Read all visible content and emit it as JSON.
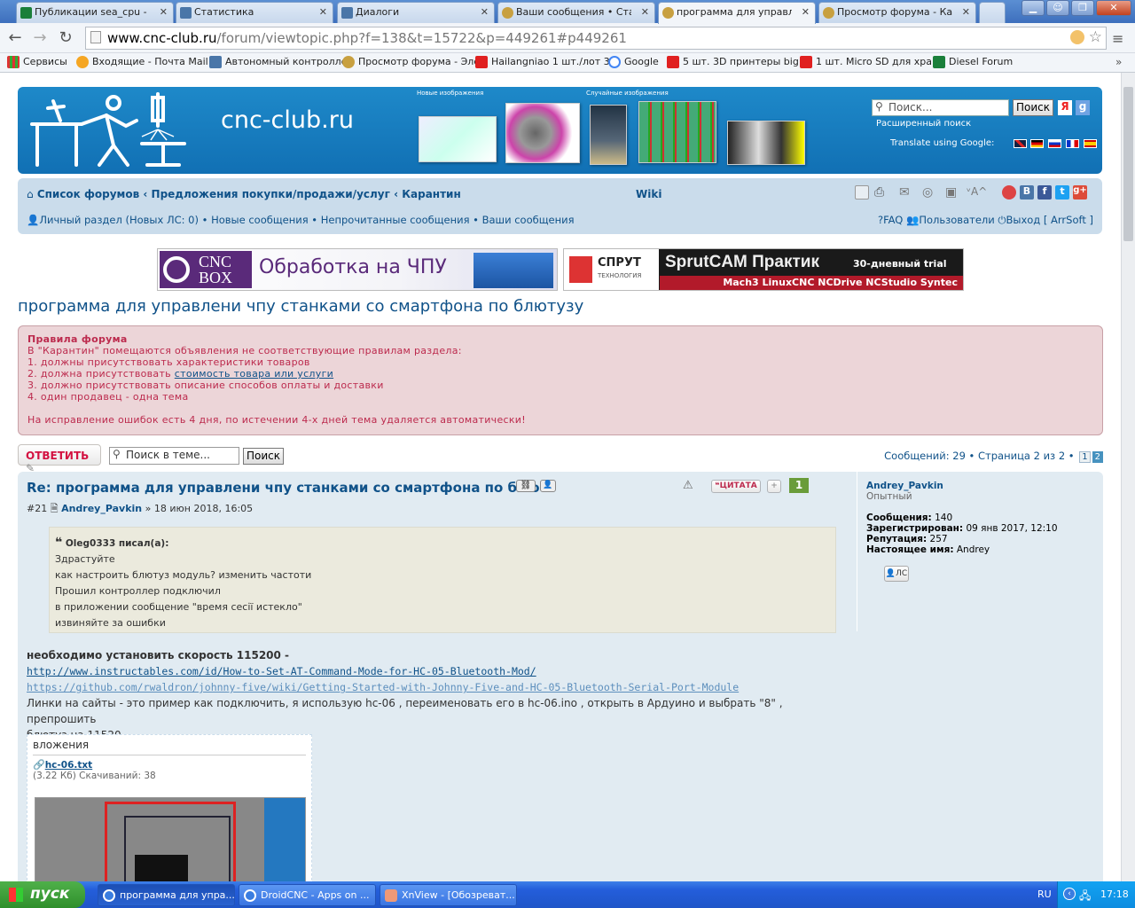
{
  "browser": {
    "tabs": [
      {
        "label": "Публикации sea_cpu - Dio",
        "color": "#1a7f3a"
      },
      {
        "label": "Статистика",
        "color": "#4a76a8"
      },
      {
        "label": "Диалоги",
        "color": "#4a76a8"
      },
      {
        "label": "Ваши сообщения • Станк",
        "color": "#c8a040"
      },
      {
        "label": "программа для управлен",
        "color": "#c8a040"
      },
      {
        "label": "Просмотр форума - Каран",
        "color": "#c8a040"
      }
    ],
    "url_host": "www.cnc-club.ru",
    "url_rest": "/forum/viewtopic.php?f=138&t=15722&p=449261#p449261",
    "bookmarks": [
      {
        "label": "Сервисы",
        "color": "#d33"
      },
      {
        "label": "Входящие - Почта Mail",
        "color": "#f5a623"
      },
      {
        "label": "Автономный контролле",
        "color": "#4a76a8"
      },
      {
        "label": "Просмотр форума - Эле",
        "color": "#c8a040"
      },
      {
        "label": "Hailangniao 1 шт./лот 3",
        "color": "#e02020"
      },
      {
        "label": "Google",
        "color": "#4285f4"
      },
      {
        "label": "5 шт. 3D принтеры big",
        "color": "#e02020"
      },
      {
        "label": "1 шт. Micro SD для хра",
        "color": "#e02020"
      },
      {
        "label": "Diesel Forum",
        "color": "#1a7f3a"
      }
    ]
  },
  "header": {
    "site_name": "cnc-club.ru",
    "new_images": "Новые изображения",
    "random_images": "Случайные изображения",
    "search_placeholder": "Поиск...",
    "search_button": "Поиск",
    "advanced_search": "Расширенный поиск",
    "translate": "Translate using Google:"
  },
  "nav": {
    "crumbs": [
      "Список форумов",
      "Предложения покупки/продажи/услуг",
      "Карантин"
    ],
    "wiki": "Wiki",
    "personal": "Личный раздел (Новых ЛС: 0)",
    "new_posts": "Новые сообщения",
    "unread": "Непрочитанные сообщения",
    "your_posts": "Ваши сообщения",
    "faq": "FAQ",
    "users": "Пользователи",
    "logout": "Выход [ ArrSoft ]"
  },
  "banners": {
    "left_brand_top": "CNC",
    "left_brand_bottom": "BOX",
    "left_text": "Обработка на ЧПУ",
    "right_brand": "СПРУТ",
    "right_brand_sub": "ТЕХНОЛОГИЯ",
    "right_title": "SprutCAM Практик",
    "right_trial": "30-дневный trial",
    "right_sub": "Mach3 LinuxCNC NCDrive NCStudio Syntec"
  },
  "topic": {
    "title": "программа для управлени чпу станками со смартфона по блютузу"
  },
  "rules": {
    "heading": "Правила форума",
    "intro": "В \"Карантин\" помещаются объявления не соответствующие правилам раздела:",
    "r1": "1. должны присутствовать характеристики товаров",
    "r2_prefix": "2. должна присутствовать ",
    "r2_link": "стоимость товара или услуги",
    "r3": "3. должно присутствовать описание способов оплаты и доставки",
    "r4": "4. один продавец - одна тема",
    "note": "На исправление ошибок есть 4 дня, по истечении 4-х дней тема удаляется автоматически!"
  },
  "actions": {
    "reply": "ОТВЕТИТЬ",
    "topic_search_placeholder": "Поиск в теме...",
    "search_button": "Поиск",
    "count_text": "Сообщений: 29",
    "page_text": "Страница 2 из 2",
    "pages": [
      "1",
      "2"
    ]
  },
  "post": {
    "title": "Re: программа для управлени чпу станками со смартфона по блю",
    "quote_btn": "ЦИТАТА",
    "number_badge": "1",
    "num": "#21",
    "author": "Andrey_Pavkin",
    "date": "» 18 июн 2018, 16:05",
    "quote_cite": "Oleg0333 писал(а):",
    "quote_lines": [
      "Здрастуйте",
      "как настроить блютуз модуль? изменить частоти",
      "Прошил контроллер подключил",
      "в приложении сообщение \"время сесії истекло\"",
      "извиняйте за ошибки"
    ],
    "bold_line": "необходимо установить скорость 115200 -",
    "link1": "http://www.instructables.com/id/How-to-Set-AT-Command-Mode-for-HC-05-Bluetooth-Mod/",
    "link2": "https://github.com/rwaldron/johnny-five/wiki/Getting-Started-with-Johnny-Five-and-HC-05-Bluetooth-Serial-Port-Module",
    "text_line1": "Линки на сайты - это пример как подключить, я использую hc-06 , переименовать его в hc-06.ino , открыть в Ардуино и выбрать \"8\" , препрошить",
    "text_line2": "блютуз на 11520",
    "attach_heading": "вложения",
    "attach_file": "hc-06.txt",
    "attach_info": "(3.22 Кб) Скачиваний: 38"
  },
  "profile": {
    "name": "Andrey_Pavkin",
    "rank": "Опытный",
    "posts_label": "Сообщения:",
    "posts": "140",
    "reg_label": "Зарегистрирован:",
    "reg": "09 янв 2017, 12:10",
    "rep_label": "Репутация:",
    "rep": "257",
    "real_label": "Настоящее имя:",
    "real": "Andrey",
    "pm": "ЛС"
  },
  "taskbar": {
    "start": "пуск",
    "items": [
      "программа для упра...",
      "DroidCNC - Apps on ...",
      "XnView - [Обозреват..."
    ],
    "lang": "RU",
    "time": "17:18"
  }
}
